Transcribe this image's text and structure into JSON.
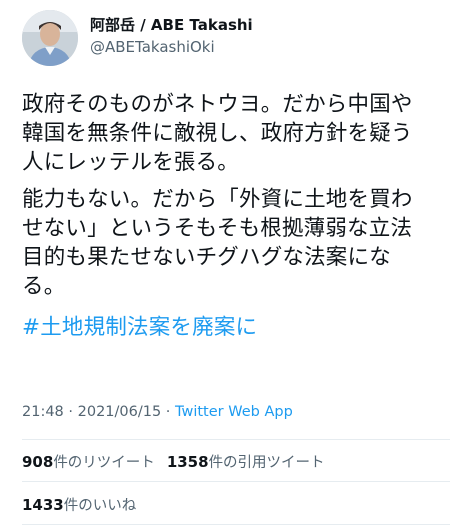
{
  "user": {
    "display_name": "阿部岳 / ABE Takashi",
    "handle": "@ABETakashiOki",
    "avatar_icon": "avatar-photo-icon"
  },
  "tweet": {
    "paragraphs": [
      [
        "政府そのものがネトウヨ。だから中国や",
        "韓国を無条件に敵視し、政府方針を疑う",
        "人にレッテルを張る。"
      ],
      [
        "能力もない。だから「外資に土地を買わ",
        "せない」というそもそも根拠薄弱な立法",
        "目的も果たせないチグハグな法案にな",
        "る。"
      ]
    ],
    "hashtag": "#土地規制法案を廃案に"
  },
  "meta": {
    "time": "21:48",
    "separator": " · ",
    "date": "2021/06/15",
    "app": "Twitter Web App"
  },
  "stats": {
    "retweets_count": "908",
    "retweets_label": "件のリツイート",
    "quotes_count": "1358",
    "quotes_label": "件の引用ツイート",
    "likes_count": "1433",
    "likes_label": "件のいいね"
  },
  "colors": {
    "link": "#1d9bf0",
    "secondary_text": "#536471",
    "primary_text": "#0f1419",
    "divider": "#e6ecf0"
  }
}
